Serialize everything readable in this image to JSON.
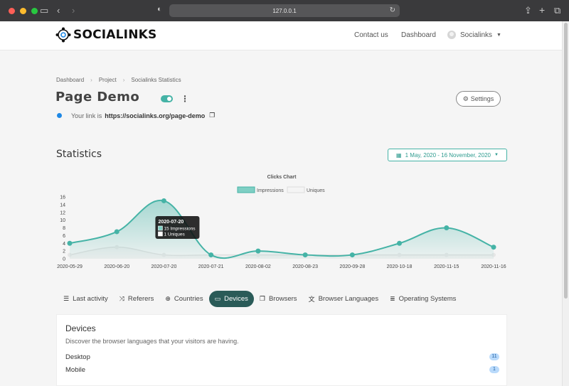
{
  "browser": {
    "url": "127.0.0.1"
  },
  "nav": {
    "brand": "SOCIALINKS",
    "contact": "Contact us",
    "dashboard": "Dashboard",
    "user": "Socialinks"
  },
  "breadcrumb": {
    "items": [
      "Dashboard",
      "Project",
      "Socialinks Statistics"
    ]
  },
  "page": {
    "title": "Page Demo",
    "settings": "Settings",
    "link_prefix": "Your link is",
    "link_url": "https://socialinks.org/page-demo",
    "enabled": true
  },
  "stats": {
    "title": "Statistics",
    "date_range": "1 May, 2020 - 16 November, 2020"
  },
  "chart_data": {
    "type": "line",
    "title": "Clicks Chart",
    "categories": [
      "2020-05-29",
      "2020-06-20",
      "2020-07-20",
      "2020-07-21",
      "2020-08-02",
      "2020-08-23",
      "2020-09-28",
      "2020-10-18",
      "2020-11-15",
      "2020-11-16"
    ],
    "series": [
      {
        "name": "Impressions",
        "values": [
          4,
          7,
          15,
          1,
          2,
          1,
          1,
          4,
          8,
          3
        ],
        "color": "#45b3a6"
      },
      {
        "name": "Uniques",
        "values": [
          1,
          3,
          1,
          1,
          1,
          1,
          1,
          1,
          1,
          1
        ],
        "color": "#e3e3e3"
      }
    ],
    "ylim": [
      0,
      16
    ],
    "yticks": [
      0,
      2,
      4,
      6,
      8,
      10,
      12,
      14,
      16
    ],
    "legend": "top",
    "grid": false,
    "tooltip": {
      "date": "2020-07-20",
      "lines": [
        "15 Impressions",
        "1 Uniques"
      ]
    }
  },
  "tabs": [
    {
      "label": "Last activity",
      "icon": "list-icon"
    },
    {
      "label": "Referers",
      "icon": "shuffle-icon"
    },
    {
      "label": "Countries",
      "icon": "globe-icon"
    },
    {
      "label": "Devices",
      "icon": "laptop-icon",
      "active": true
    },
    {
      "label": "Browsers",
      "icon": "windows-icon"
    },
    {
      "label": "Browser Languages",
      "icon": "language-icon"
    },
    {
      "label": "Operating Systems",
      "icon": "server-icon"
    }
  ],
  "panel": {
    "title": "Devices",
    "description": "Discover the browser languages that your visitors are having.",
    "rows": [
      {
        "label": "Desktop",
        "count": "11"
      },
      {
        "label": "Mobile",
        "count": "1"
      }
    ]
  },
  "colors": {
    "accent": "#45b3a6",
    "active_tab": "#2a5b58",
    "badge": "#b9dafb"
  }
}
